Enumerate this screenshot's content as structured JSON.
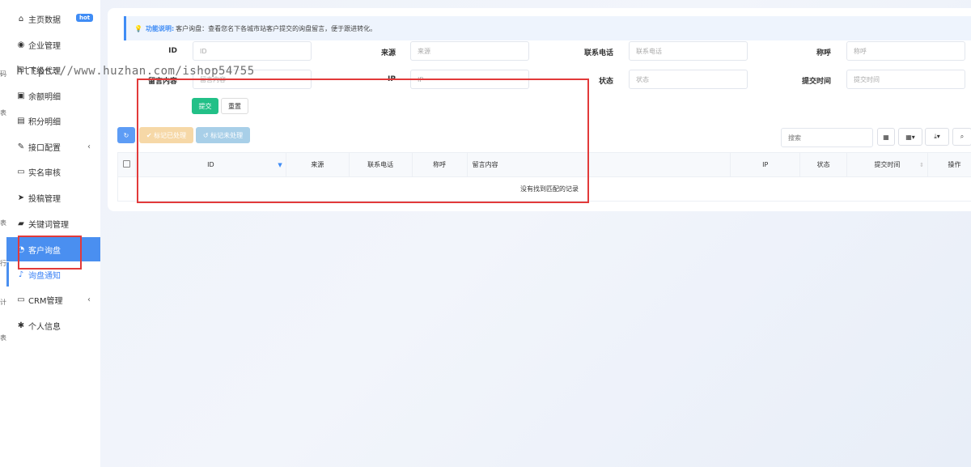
{
  "sidebar": {
    "items": [
      {
        "label": "主页数据",
        "icon": "home-icon",
        "badge": "hot"
      },
      {
        "label": "企业管理",
        "icon": "user-circle-icon"
      },
      {
        "label": "下级代理",
        "icon": "sitemap-icon"
      },
      {
        "label": "余额明细",
        "icon": "money-icon"
      },
      {
        "label": "积分明细",
        "icon": "list-icon"
      },
      {
        "label": "接口配置",
        "icon": "plug-icon",
        "caret": "‹"
      },
      {
        "label": "实名审核",
        "icon": "id-card-icon"
      },
      {
        "label": "投稿管理",
        "icon": "send-icon"
      },
      {
        "label": "关键词管理",
        "icon": "book-icon"
      },
      {
        "label": "客户询盘",
        "icon": "chart-pie-icon"
      },
      {
        "label": "询盘通知",
        "icon": "bell-icon"
      },
      {
        "label": "CRM管理",
        "icon": "address-card-icon",
        "caret": "‹"
      },
      {
        "label": "个人信息",
        "icon": "gear-icon"
      }
    ]
  },
  "notice": {
    "label": "功能说明:",
    "text": "客户询盘：查看您名下各城市站客户提交的询盘留言，便于跟进转化。"
  },
  "filters": {
    "id_label": "ID",
    "id_placeholder": "ID",
    "source_label": "来源",
    "source_placeholder": "来源",
    "phone_label": "联系电话",
    "phone_placeholder": "联系电话",
    "title_label": "称呼",
    "title_placeholder": "称呼",
    "message_label": "留言内容",
    "message_placeholder": "留言内容",
    "ip_label": "IP",
    "ip_placeholder": "IP",
    "status_label": "状态",
    "status_placeholder": "状态",
    "time_label": "提交时间",
    "time_placeholder": "提交时间",
    "submit": "提交",
    "reset": "重置"
  },
  "toolbar": {
    "refresh_icon": "↻",
    "mark_done": "标记已处理",
    "mark_undone": "标记未处理",
    "search_placeholder": "搜索"
  },
  "table": {
    "columns": [
      "ID",
      "来源",
      "联系电话",
      "称呼",
      "留言内容",
      "IP",
      "状态",
      "提交时间",
      "操作"
    ],
    "empty": "没有找到匹配的记录"
  },
  "watermark": "https://www.huzhan.com/ishop54755",
  "edge_chars": [
    "码",
    "表",
    "表",
    "行",
    "计",
    "表"
  ],
  "colors": {
    "accent": "#4a8ff0",
    "submit": "#22c087",
    "annotation": "#e23a3a"
  }
}
